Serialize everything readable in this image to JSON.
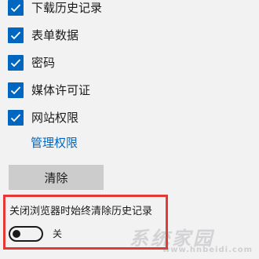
{
  "checkboxes": [
    {
      "label": "下载历史记录",
      "checked": true
    },
    {
      "label": "表单数据",
      "checked": true
    },
    {
      "label": "密码",
      "checked": true
    },
    {
      "label": "媒体许可证",
      "checked": true
    },
    {
      "label": "网站权限",
      "checked": true
    }
  ],
  "manage_permissions_link": "管理权限",
  "clear_button": "清除",
  "always_clear_setting": {
    "label": "关闭浏览器时始终清除历史记录",
    "toggle_on": false,
    "state_text": "关"
  },
  "colors": {
    "accent": "#0067c0",
    "highlight_border": "#e53935",
    "background": "#f2f2f2"
  },
  "watermark": {
    "main": "系统家园",
    "sub": "www.hnbeidi.com"
  }
}
